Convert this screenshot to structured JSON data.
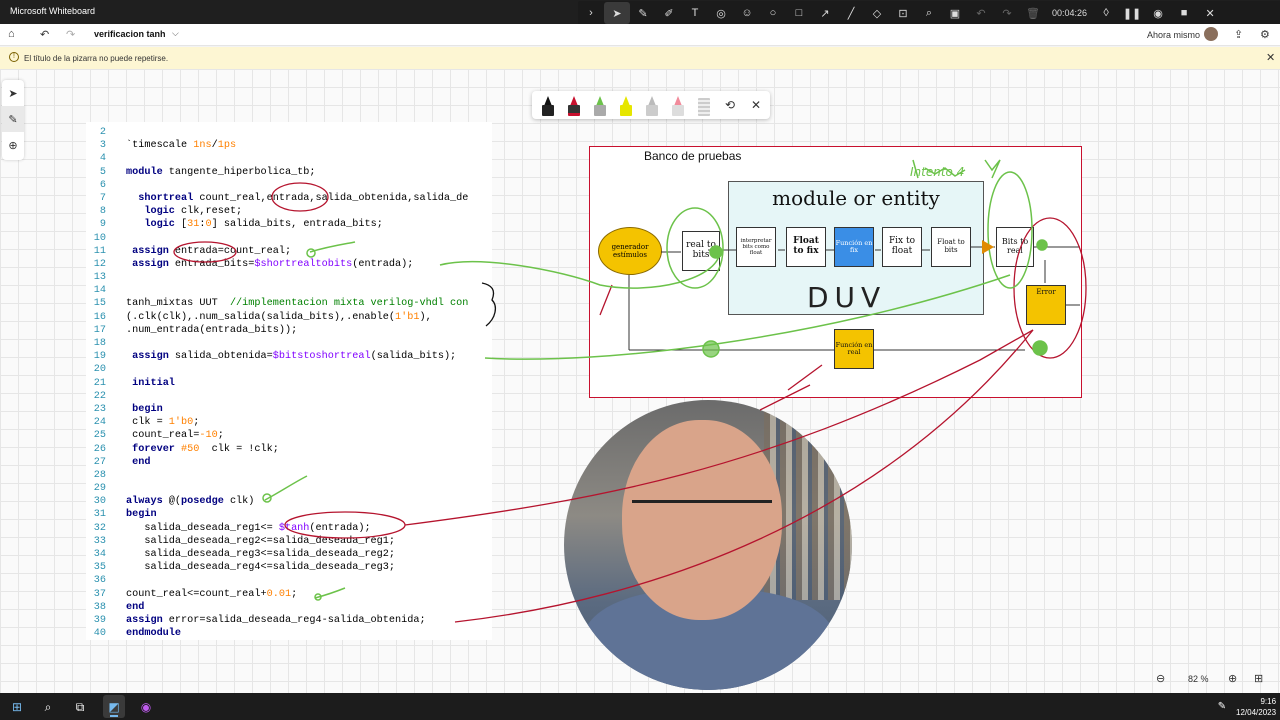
{
  "window": {
    "app_title": "Microsoft Whiteboard"
  },
  "floating_toolbar": {
    "timer": "00:04:26"
  },
  "header": {
    "board_name": "verificacion tanh",
    "saved_status": "Ahora mismo"
  },
  "notice": {
    "message": "El título de la pizarra no puede repetirse."
  },
  "code": {
    "lines": [
      {
        "n": "2",
        "text": ""
      },
      {
        "n": "3",
        "text": "`timescale 1ns/1ps"
      },
      {
        "n": "4",
        "text": ""
      },
      {
        "n": "5",
        "text": "module tangente_hiperbolica_tb;"
      },
      {
        "n": "6",
        "text": ""
      },
      {
        "n": "7",
        "text": "  shortreal count_real,entrada,salida_obtenida,salida_de"
      },
      {
        "n": "8",
        "text": "   logic clk,reset;"
      },
      {
        "n": "9",
        "text": "   logic [31:0] salida_bits, entrada_bits;"
      },
      {
        "n": "10",
        "text": ""
      },
      {
        "n": "11",
        "text": " assign entrada=count_real;"
      },
      {
        "n": "12",
        "text": " assign entrada_bits=$shortrealtobits(entrada);"
      },
      {
        "n": "13",
        "text": ""
      },
      {
        "n": "14",
        "text": ""
      },
      {
        "n": "15",
        "text": "tanh_mixtas UUT  //implementacion mixta verilog-vhdl con"
      },
      {
        "n": "16",
        "text": "(.clk(clk),.num_salida(salida_bits),.enable(1'b1),"
      },
      {
        "n": "17",
        "text": ".num_entrada(entrada_bits));"
      },
      {
        "n": "18",
        "text": ""
      },
      {
        "n": "19",
        "text": " assign salida_obtenida=$bitstoshortreal(salida_bits);"
      },
      {
        "n": "20",
        "text": ""
      },
      {
        "n": "21",
        "text": " initial"
      },
      {
        "n": "22",
        "text": ""
      },
      {
        "n": "23",
        "text": " begin"
      },
      {
        "n": "24",
        "text": " clk = 1'b0;"
      },
      {
        "n": "25",
        "text": " count_real=-10;"
      },
      {
        "n": "26",
        "text": " forever #50  clk = !clk;"
      },
      {
        "n": "27",
        "text": " end"
      },
      {
        "n": "28",
        "text": ""
      },
      {
        "n": "29",
        "text": ""
      },
      {
        "n": "30",
        "text": "always @(posedge clk)"
      },
      {
        "n": "31",
        "text": "begin"
      },
      {
        "n": "32",
        "text": "   salida_deseada_reg1<= $tanh(entrada);"
      },
      {
        "n": "33",
        "text": "   salida_deseada_reg2<=salida_deseada_reg1;"
      },
      {
        "n": "34",
        "text": "   salida_deseada_reg3<=salida_deseada_reg2;"
      },
      {
        "n": "35",
        "text": "   salida_deseada_reg4<=salida_deseada_reg3;"
      },
      {
        "n": "36",
        "text": ""
      },
      {
        "n": "37",
        "text": "count_real<=count_real+0.01;"
      },
      {
        "n": "38",
        "text": "end"
      },
      {
        "n": "39",
        "text": "assign error=salida_deseada_reg4-salida_obtenida;"
      },
      {
        "n": "40",
        "text": "endmodule"
      }
    ]
  },
  "diagram": {
    "bench_label": "Banco de pruebas",
    "module_title": "module or entity",
    "generator": "generador estímulos",
    "real_to_bits": "real to bits",
    "interpretar": "interpretar bits como float",
    "float_to_fix": "Float to fix",
    "funcion_fix": "Función en fix",
    "fix_to_float": "Fix to float",
    "float_to_bits": "Float to bits",
    "bits_to_real": "Bits to real",
    "error": "Error",
    "funcion_real": "Función en real",
    "handwritten_duv": "DUV",
    "handwritten_note": "Intento 4"
  },
  "zoom": {
    "level": "82 %"
  },
  "taskbar": {
    "time": "9:16",
    "date": "12/04/2023"
  }
}
